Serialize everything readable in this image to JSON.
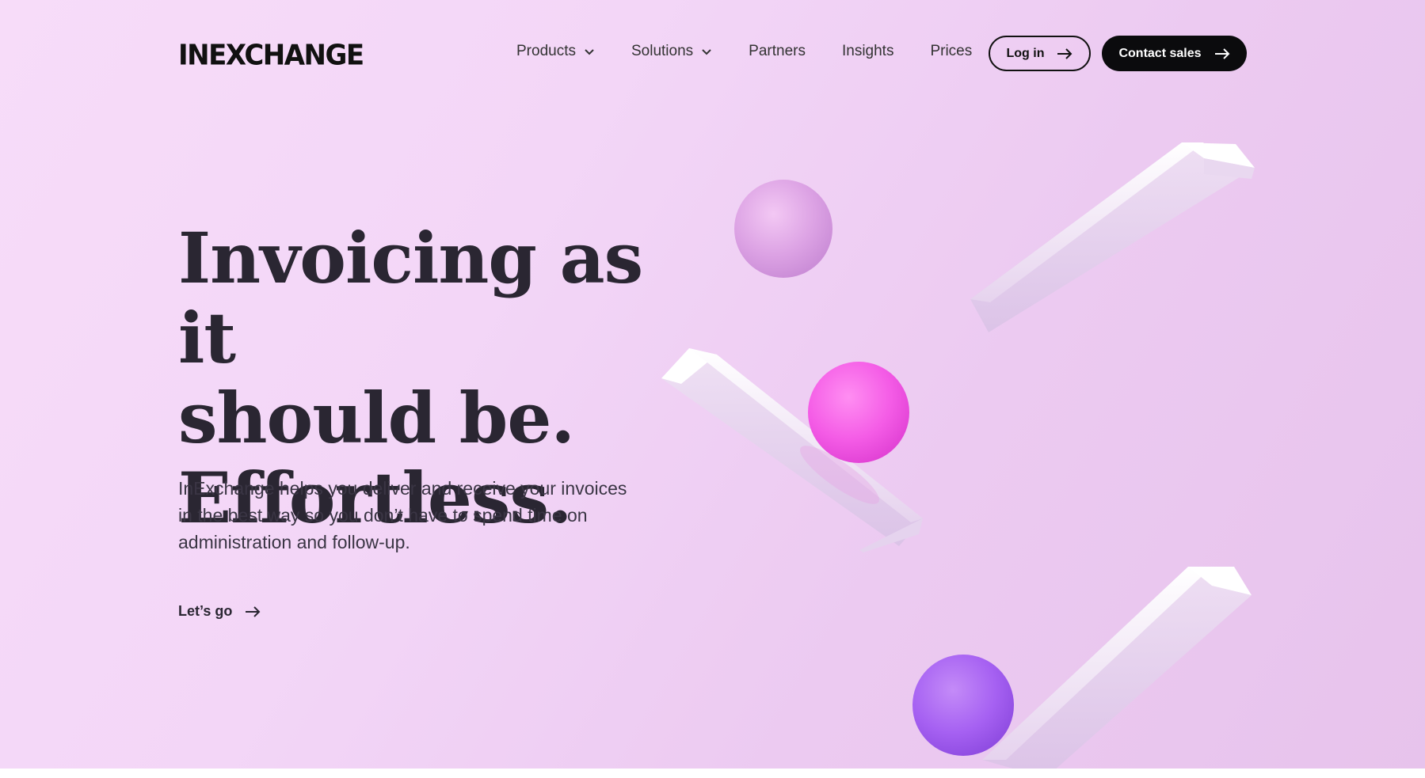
{
  "header": {
    "logo_text": "INEXCHANGE",
    "nav": [
      {
        "label": "Products",
        "has_dropdown": true
      },
      {
        "label": "Solutions",
        "has_dropdown": true
      },
      {
        "label": "Partners",
        "has_dropdown": false
      },
      {
        "label": "Insights",
        "has_dropdown": false
      },
      {
        "label": "Prices",
        "has_dropdown": false
      }
    ],
    "login_label": "Log in",
    "contact_label": "Contact sales"
  },
  "hero": {
    "title_lines": [
      "Invoicing as it",
      "should be.",
      "Effortless."
    ],
    "description": "InExchange helps you deliver and receive your invoices in the best way so you don’t have to spend time on administration and follow-up.",
    "cta_label": "Let’s go"
  },
  "icons": {
    "dropdown": "chevron-down-icon",
    "arrow": "arrow-right-icon"
  },
  "colors": {
    "background": "#f3d6f7",
    "primary_button": "#0b0b0d",
    "text": "#2a2632",
    "sphere_light": "#d99ae3",
    "sphere_pink": "#f060e0",
    "sphere_purple": "#a55cf0"
  }
}
